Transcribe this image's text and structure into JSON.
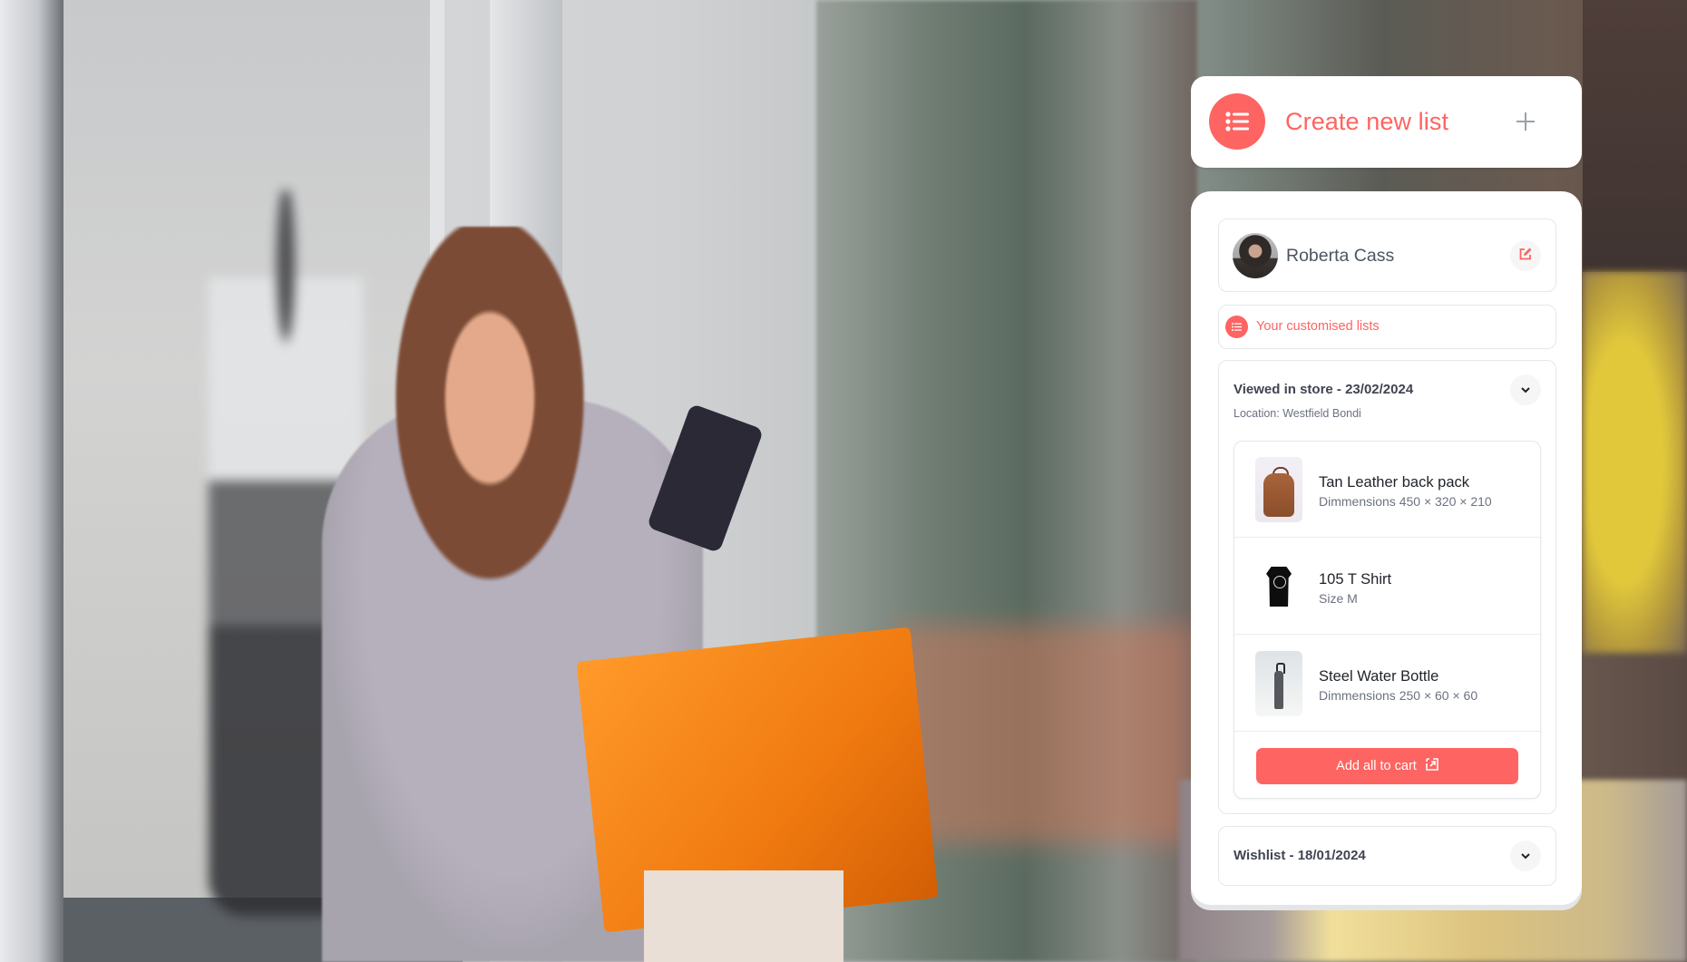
{
  "colors": {
    "accent": "#fe6461",
    "card_bg": "#ffffff",
    "border": "#e6e7ea",
    "text_primary": "#1f2328",
    "text_secondary": "#6b7280",
    "plus_icon": "#9aa0ad"
  },
  "background": {
    "description": "Photo of a smiling woman holding a smartphone and orange shopping bag in front of a store window"
  },
  "create_list": {
    "icon": "list-icon",
    "label": "Create new list",
    "action_icon": "plus-icon"
  },
  "profile": {
    "name": "Roberta Cass",
    "avatar": "avatar",
    "edit_icon": "edit-icon"
  },
  "customised_lists": {
    "icon": "list-icon",
    "label": "Your customised lists"
  },
  "lists": [
    {
      "title": "Viewed in store - 23/02/2024",
      "location": "Location: Westfield Bondi",
      "expanded": true,
      "toggle_icon": "chevron-down-icon",
      "items": [
        {
          "name": "Tan Leather back pack",
          "meta": "Dimmensions 450 × 320 × 210",
          "thumbnail": "backpack"
        },
        {
          "name": "105 T Shirt",
          "meta": "Size M",
          "thumbnail": "t-shirt"
        },
        {
          "name": "Steel Water Bottle",
          "meta": "Dimmensions 250 × 60 × 60",
          "thumbnail": "water-bottle"
        }
      ],
      "cart_button": {
        "label": "Add all to cart",
        "icon": "add-to-cart-icon"
      }
    },
    {
      "title": "Wishlist - 18/01/2024",
      "expanded": false,
      "toggle_icon": "chevron-down-icon"
    }
  ]
}
